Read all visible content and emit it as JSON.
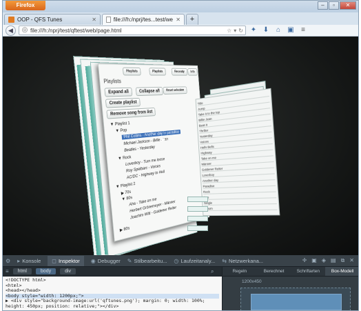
{
  "browser": {
    "app_button": "Firefox",
    "tabs": [
      {
        "title": "OOP - QFS Tunes",
        "active": false
      },
      {
        "title": "file:///h:/nprj/tes...test/web/page.html",
        "active": true
      }
    ],
    "new_tab": "+",
    "url": "file:///h:/nprj/test/qftest/web/page.html"
  },
  "playlist_app": {
    "heading": "Playlists",
    "top_tabs": [
      "Playlists",
      "Playlists",
      "Recently",
      "Info"
    ],
    "actions": {
      "expand_all": "Expand all",
      "collapse_all": "Collapse all",
      "reset_selection": "Reset selection",
      "create_playlist": "Create playlist",
      "remove_song": "Remove song from list"
    },
    "tree": [
      {
        "label": "▼ Playlist 1",
        "kind": "folder"
      },
      {
        "label": "▼ Pop",
        "kind": "folder"
      },
      {
        "label": "Phil Collins - Another day in paradise",
        "kind": "song",
        "selected": true
      },
      {
        "label": "Michael Jackson - Billie Jean",
        "kind": "song"
      },
      {
        "label": "Beatles - Yesterday",
        "kind": "song"
      },
      {
        "label": "▼ Rock",
        "kind": "folder"
      },
      {
        "label": "Loverboy - Turn me loose",
        "kind": "song"
      },
      {
        "label": "Roy Spelbarc - Voices",
        "kind": "song"
      },
      {
        "label": "AC/DC - Highway to Hell",
        "kind": "song"
      },
      {
        "label": "▼ Playlist 2",
        "kind": "folder"
      },
      {
        "label": "▶ 70s",
        "kind": "folder"
      },
      {
        "label": "▼ 80s",
        "kind": "folder"
      },
      {
        "label": "Aha - Take on me",
        "kind": "song"
      },
      {
        "label": "Herbert Grönemeyer - Männer",
        "kind": "song"
      },
      {
        "label": "Joachim Witt - Goldener Reiter",
        "kind": "song"
      },
      {
        "label": "▶ 80s",
        "kind": "folder"
      }
    ],
    "right_list_rows": [
      "Title",
      "Jump",
      "Take it to the top",
      "Billie Jean",
      "Beat It",
      "Thriller",
      "Yesterday",
      "Voices",
      "Hells Bells",
      "Highway",
      "Take on me",
      "Männer",
      "Goldener Reiter",
      "Loverboy",
      "Another day",
      "Paradise",
      "Rock",
      "Pop",
      "Single",
      "Album"
    ]
  },
  "devtools": {
    "tabs": [
      {
        "label": "Konsole",
        "icon": "console-icon"
      },
      {
        "label": "Inspektor",
        "icon": "inspector-icon",
        "active": true
      },
      {
        "label": "Debugger",
        "icon": "debugger-icon"
      },
      {
        "label": "Stilbearbeitu...",
        "icon": "style-editor-icon"
      },
      {
        "label": "Laufzeitanaly...",
        "icon": "profiler-icon"
      },
      {
        "label": "Netzwerkana...",
        "icon": "network-icon"
      }
    ],
    "breadcrumbs": [
      "html",
      "body",
      "div"
    ],
    "markup_lines": [
      "<!DOCTYPE html>",
      "<html>",
      "  <head></head>",
      "  <body style=\"width: 1200px;\">",
      "    ▶ <div style=\"background-image:url('qftunes.png'); margin: 0; width: 100%;",
      "      height: 450px; position: relative;\"></div>"
    ],
    "side_tabs": [
      "Regeln",
      "Berechnet",
      "Schriftarten",
      "Box-Modell"
    ],
    "box_model_size": "1200x450"
  }
}
